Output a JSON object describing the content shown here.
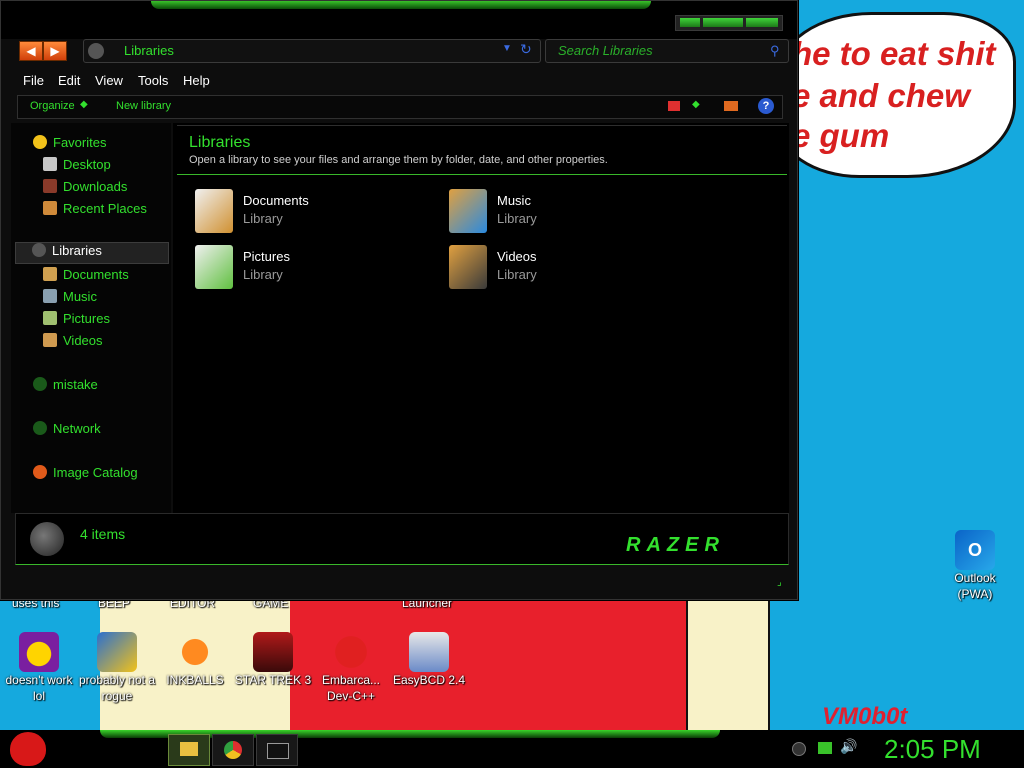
{
  "wallpaper": {
    "bubble_lines": [
      "he to eat shit",
      "e and chew",
      "e gum"
    ],
    "signature": "VM0b0t"
  },
  "window": {
    "address": "Libraries",
    "search_placeholder": "Search Libraries",
    "menu": [
      "File",
      "Edit",
      "View",
      "Tools",
      "Help"
    ],
    "commands": {
      "organize": "Organize",
      "new_library": "New library"
    },
    "sidebar": {
      "favorites": "Favorites",
      "fav_items": [
        "Desktop",
        "Downloads",
        "Recent Places"
      ],
      "libraries": "Libraries",
      "lib_items": [
        "Documents",
        "Music",
        "Pictures",
        "Videos"
      ],
      "mistake": "mistake",
      "network": "Network",
      "image_catalog": "Image Catalog"
    },
    "header": {
      "title": "Libraries",
      "description": "Open a library to see your files and arrange them by folder, date, and other properties."
    },
    "libraries": [
      {
        "name": "Documents",
        "type": "Library"
      },
      {
        "name": "Music",
        "type": "Library"
      },
      {
        "name": "Pictures",
        "type": "Library"
      },
      {
        "name": "Videos",
        "type": "Library"
      }
    ],
    "status": "4 items",
    "brand": "RAZER"
  },
  "desktop": {
    "partial_labels": [
      "uses this",
      "BEEP",
      "EDITOR",
      "GAME",
      "Launcher"
    ],
    "icons": [
      {
        "label": "doesn't work lol"
      },
      {
        "label": "probably not a rogue"
      },
      {
        "label": "INKBALLS"
      },
      {
        "label": "STAR TREK 3"
      },
      {
        "label": "Embarca... Dev-C++"
      },
      {
        "label": "EasyBCD 2.4"
      },
      {
        "label": "Outlook (PWA)"
      }
    ]
  },
  "taskbar": {
    "clock": "2:05 PM"
  },
  "colors": {
    "accent": "#33e02e",
    "window_bg": "#000000",
    "desktop": "#15a9de"
  }
}
